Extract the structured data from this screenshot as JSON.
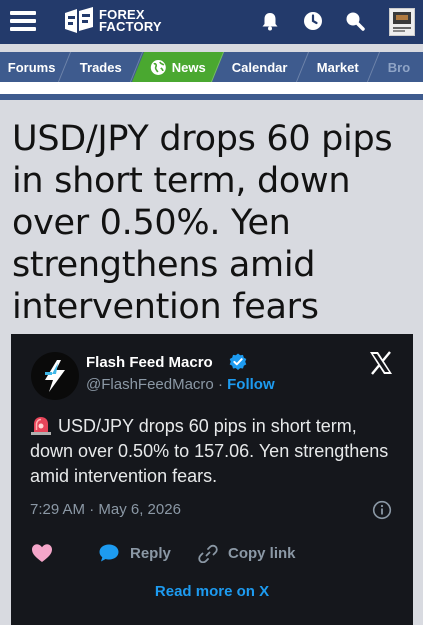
{
  "header": {
    "logo_line1": "FOREX",
    "logo_line2": "FACTORY",
    "icons": [
      "menu-icon",
      "bell-icon",
      "clock-icon",
      "search-icon",
      "avatar-icon"
    ]
  },
  "nav": {
    "tabs": [
      {
        "label": "Forums"
      },
      {
        "label": "Trades"
      },
      {
        "label": "News",
        "active": true
      },
      {
        "label": "Calendar"
      },
      {
        "label": "Market"
      },
      {
        "label": "Bro"
      }
    ]
  },
  "article": {
    "headline": "USD/JPY drops 60 pips in short term, down over 0.50%. Yen strengthens amid intervention fears"
  },
  "tweet": {
    "author_name": "Flash Feed Macro",
    "handle": "@FlashFeedMacro",
    "separator": "·",
    "follow_label": "Follow",
    "text": "USD/JPY drops 60 pips in short term, down over 0.50% to 157.06. Yen strengthens amid intervention fears.",
    "timestamp": "7:29 AM · May 6, 2026",
    "reply_label": "Reply",
    "copy_link_label": "Copy link",
    "read_more_label": "Read more on X"
  },
  "colors": {
    "header_bg": "#233a6b",
    "nav_bg": "#3e5b8e",
    "active_tab": "#4aa830",
    "tweet_bg": "#15171c",
    "link_blue": "#1d9bf0",
    "like_pink": "#f4a6c9"
  }
}
